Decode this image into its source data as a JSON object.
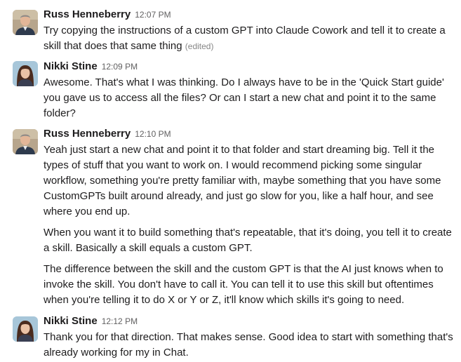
{
  "messages": [
    {
      "author": "Russ Henneberry",
      "time": "12:07 PM",
      "paragraphs": [
        "Try copying the instructions of a custom GPT into Claude Cowork and tell it to create a skill that does that same thing"
      ],
      "edited": "(edited)"
    },
    {
      "author": "Nikki Stine",
      "time": "12:09 PM",
      "paragraphs": [
        "Awesome. That's what I was thinking. Do I always have to be in the 'Quick Start guide' you gave us to access all the files? Or can I start a new chat and point it to the same folder?"
      ]
    },
    {
      "author": "Russ Henneberry",
      "time": "12:10 PM",
      "paragraphs": [
        "Yeah just start a new chat and point it to that folder and start dreaming big. Tell it the types of stuff that you want to work on. I would recommend picking some singular workflow, something you're pretty familiar with, maybe something that you have some CustomGPTs built around already, and just go slow for you, like a half hour, and see where you end up.",
        "When you want it to build something that's repeatable, that it's doing, you tell it to create a skill. Basically a skill equals a custom GPT.",
        "The difference between the skill and the custom GPT is that the AI just knows when to invoke the skill. You don't have to call it. You can tell it to use this skill but oftentimes when you're telling it to do X or Y or Z, it'll know which skills it's going to need."
      ]
    },
    {
      "author": "Nikki Stine",
      "time": "12:12 PM",
      "paragraphs": [
        "Thank you for that direction. That makes sense. Good idea to start with something that's already working for my in Chat."
      ]
    }
  ]
}
